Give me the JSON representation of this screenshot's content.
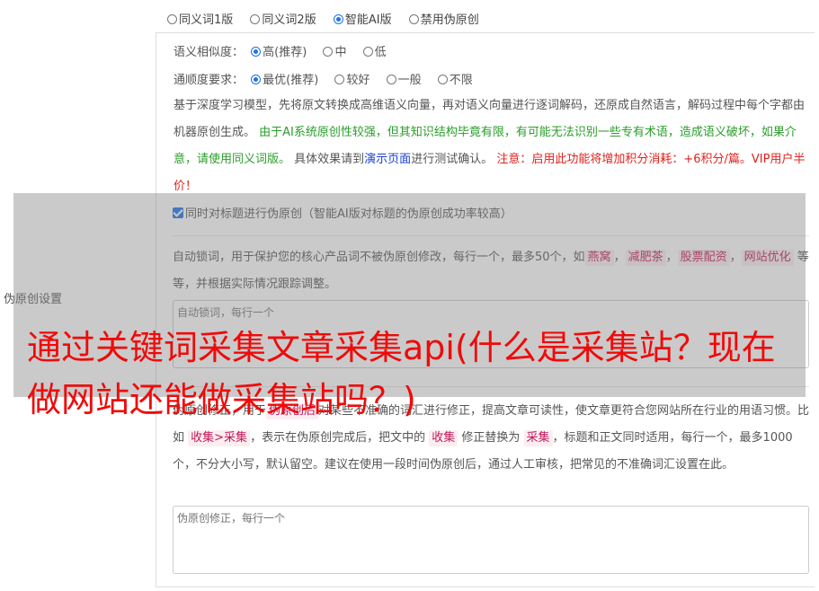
{
  "version_options": [
    {
      "label": "同义词1版",
      "checked": false
    },
    {
      "label": "同义词2版",
      "checked": false
    },
    {
      "label": "智能AI版",
      "checked": true
    },
    {
      "label": "禁用伪原创",
      "checked": false
    }
  ],
  "similarity": {
    "label": "语义相似度：",
    "options": [
      {
        "label": "高(推荐)",
        "checked": true
      },
      {
        "label": "中",
        "checked": false
      },
      {
        "label": "低",
        "checked": false
      }
    ]
  },
  "fluency": {
    "label": "通顺度要求：",
    "options": [
      {
        "label": "最优(推荐)",
        "checked": true
      },
      {
        "label": "较好",
        "checked": false
      },
      {
        "label": "一般",
        "checked": false
      },
      {
        "label": "不限",
        "checked": false
      }
    ]
  },
  "description": {
    "part1": "基于深度学习模型，先将原文转换成高维语义向量，再对语义向量进行逐词解码，还原成自然语言，解码过程中每个字都由机器原创生成。",
    "part2_green": "由于AI系统原创性较强，但其知识结构毕竟有限，有可能无法识别一些专有术语，造成语义破坏，如果介意，请使用同义词版。",
    "part3": "具体效果请到",
    "demo_link": "演示页面",
    "part4": "进行测试确认。",
    "warning_red": "注意：启用此功能将增加积分消耗：+6积分/篇。VIP用户半价！"
  },
  "title_checkbox": {
    "label": "同时对标题进行伪原创（智能AI版对标题的伪原创成功率较高）",
    "checked": true
  },
  "side_label": "伪原创设置",
  "lock_words": {
    "text1": "自动锁词，用于保护您的核心产品词不被伪原创修改，每行一个，最多50个，如",
    "examples": [
      "燕窝",
      "减肥茶",
      "股票配资",
      "网站优化"
    ],
    "text2": "等等，并根据实际情况跟踪调整。",
    "placeholder": "自动锁词，每行一个"
  },
  "fix_words": {
    "text1": "伪原创修正，用于",
    "tag1": "伪原创后",
    "text2": "对某些不准确的词汇进行修正，提高文章可读性，使文章更符合您网站所在行业的用语习惯。比如",
    "tag2": "收集>采集",
    "text3": "，表示在伪原创完成后，把文中的",
    "tag3": "收集",
    "text4": "修正替换为",
    "tag4": "采集",
    "text5": "，标题和正文同时适用，每行一个，最多1000个，不分大小写，默认留空。建议在使用一段时间伪原创后，通过人工审核，把常见的不准确词汇设置在此。",
    "placeholder": "伪原创修正，每行一个"
  },
  "headline": "通过关键词采集文章采集api(什么是采集站？现在做网站还能做采集站吗？)",
  "colors": {
    "accent": "#1a73e8",
    "green": "#2a9d2a",
    "red": "#e0211d",
    "link": "#1a3fd8",
    "headline": "#f00a0a"
  }
}
